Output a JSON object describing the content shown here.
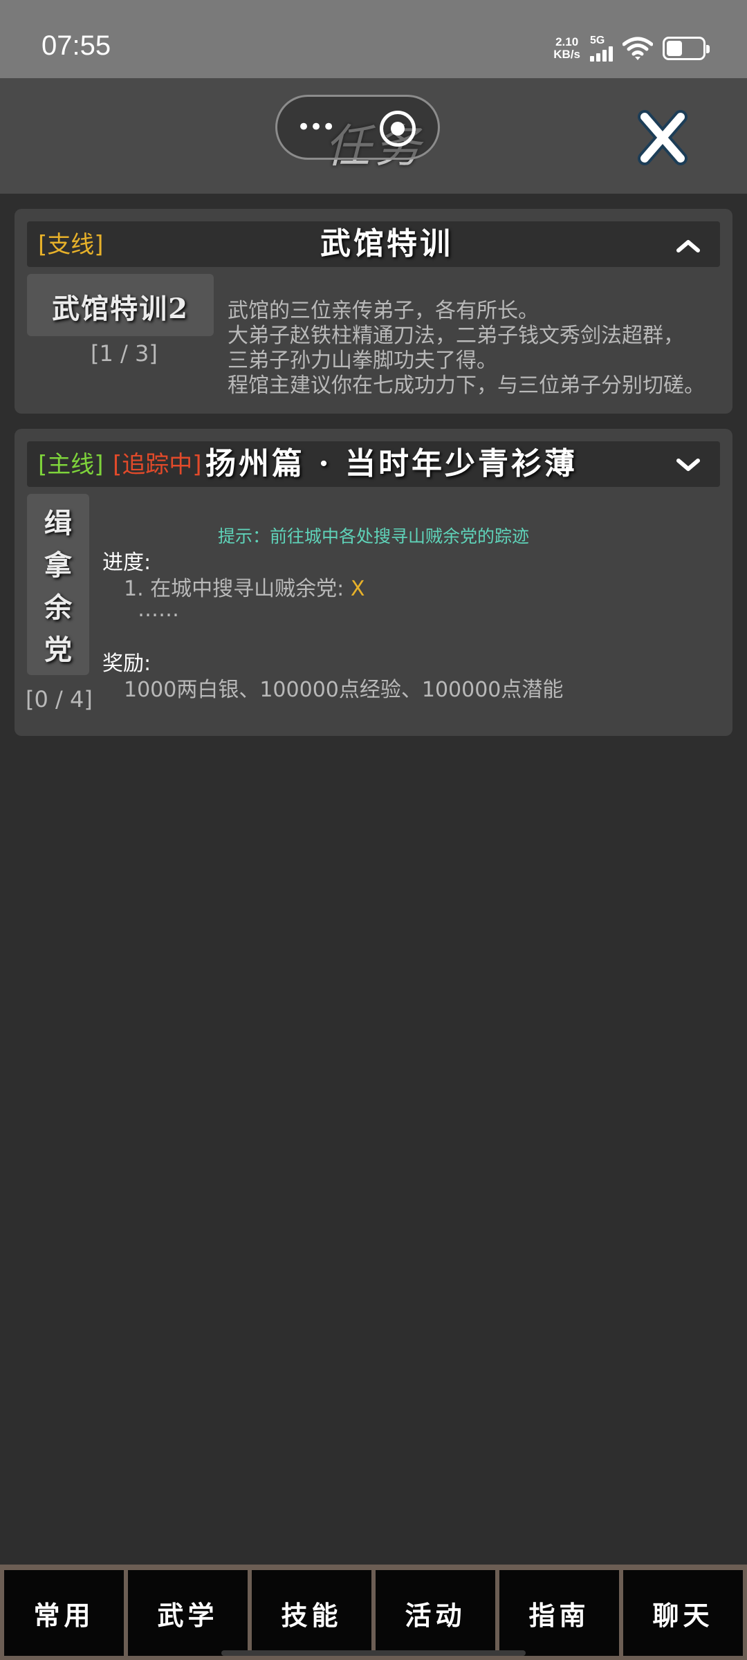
{
  "status_bar": {
    "time": "07:55",
    "net_speed_value": "2.10",
    "net_speed_unit": "KB/s",
    "signal_label": "5G",
    "icons": [
      "signal-icon",
      "wifi-icon",
      "battery-icon"
    ]
  },
  "header": {
    "title": "任务",
    "capsule_more": "•••",
    "close_icon": "close-icon"
  },
  "quests": [
    {
      "tags": [
        "[支线]"
      ],
      "title": "武馆特训",
      "expanded": true,
      "badge": "武馆特训2",
      "progress": "[1 / 3]",
      "description": [
        "武馆的三位亲传弟子，各有所长。",
        "大弟子赵铁柱精通刀法，二弟子钱文秀剑法超群，",
        "三弟子孙力山拳脚功夫了得。",
        "程馆主建议你在七成功力下，与三位弟子分别切磋。"
      ]
    },
    {
      "tags": [
        "[主线]",
        "[追踪中]"
      ],
      "title": "扬州篇 · 当时年少青衫薄",
      "expanded": false,
      "badge": [
        "缉",
        "拿",
        "余",
        "党"
      ],
      "progress": "[0 / 4]",
      "hint": "提示：前往城中各处搜寻山贼余党的踪迹",
      "progress_label": "进度:",
      "progress_items": [
        "1. 在城中搜寻山贼余党: ",
        "X",
        "……"
      ],
      "reward_label": "奖励:",
      "reward": "1000两白银、100000点经验、100000点潜能"
    }
  ],
  "bottom_nav": [
    "常用",
    "武学",
    "技能",
    "活动",
    "指南",
    "聊天"
  ],
  "colors": {
    "tag_yellow": "#e7b12a",
    "tag_green": "#7ed33b",
    "tag_red": "#e24a2a",
    "hint": "#5fd3b9"
  }
}
